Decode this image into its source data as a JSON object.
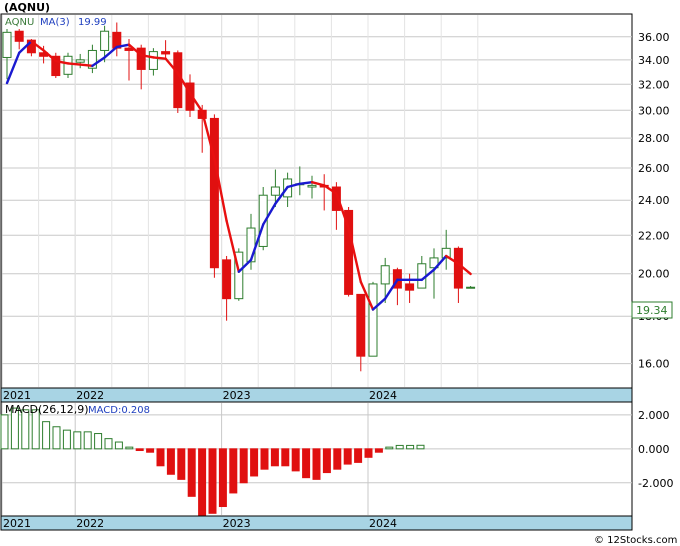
{
  "title": "(AQNU)",
  "watermark": "© 12Stocks.com",
  "colors": {
    "up": "#2e7d2e",
    "down": "#e01010",
    "ma_up": "#1a1ad0",
    "ma_down": "#e81010",
    "axis_band": "#a8d4e4",
    "grid": "#c8c8c8"
  },
  "chart_data": [
    {
      "type": "candlestick",
      "legend": {
        "symbol": "AQNU",
        "ma_label": "MA(3)",
        "ma_value": "19.99",
        "placement": "top-left"
      },
      "last_price": "19.34",
      "y_ticks": [
        "16.00",
        "18.00",
        "20.00",
        "22.00",
        "24.00",
        "26.00",
        "28.00",
        "30.00",
        "32.00",
        "34.00",
        "36.00"
      ],
      "ylim": [
        15.1,
        38.0
      ],
      "log_scale": true,
      "grid": true,
      "x_year_labels": [
        {
          "label": "2021",
          "index": 0
        },
        {
          "label": "2022",
          "index": 6
        },
        {
          "label": "2023",
          "index": 18
        },
        {
          "label": "2024",
          "index": 30
        }
      ],
      "candles": [
        {
          "o": 34.2,
          "h": 36.7,
          "l": 32.4,
          "c": 36.4
        },
        {
          "o": 36.5,
          "h": 36.7,
          "l": 34.9,
          "c": 35.6
        },
        {
          "o": 35.7,
          "h": 35.8,
          "l": 34.3,
          "c": 34.6
        },
        {
          "o": 34.6,
          "h": 35.2,
          "l": 33.7,
          "c": 34.3
        },
        {
          "o": 34.3,
          "h": 34.6,
          "l": 32.5,
          "c": 32.7
        },
        {
          "o": 32.8,
          "h": 34.6,
          "l": 32.5,
          "c": 34.3
        },
        {
          "o": 33.8,
          "h": 34.5,
          "l": 33.3,
          "c": 34.0
        },
        {
          "o": 33.3,
          "h": 35.3,
          "l": 32.9,
          "c": 34.8
        },
        {
          "o": 34.8,
          "h": 37.0,
          "l": 33.8,
          "c": 36.5
        },
        {
          "o": 36.4,
          "h": 37.3,
          "l": 34.3,
          "c": 35.0
        },
        {
          "o": 35.0,
          "h": 35.8,
          "l": 32.3,
          "c": 34.8
        },
        {
          "o": 35.0,
          "h": 35.3,
          "l": 31.6,
          "c": 33.2
        },
        {
          "o": 33.2,
          "h": 35.0,
          "l": 32.7,
          "c": 34.7
        },
        {
          "o": 34.7,
          "h": 35.7,
          "l": 34.2,
          "c": 34.5
        },
        {
          "o": 34.6,
          "h": 34.8,
          "l": 29.8,
          "c": 30.2
        },
        {
          "o": 32.1,
          "h": 32.8,
          "l": 29.5,
          "c": 30.0
        },
        {
          "o": 30.0,
          "h": 30.4,
          "l": 27.0,
          "c": 29.4
        },
        {
          "o": 29.4,
          "h": 29.7,
          "l": 19.8,
          "c": 20.3
        },
        {
          "o": 20.7,
          "h": 20.9,
          "l": 17.8,
          "c": 18.8
        },
        {
          "o": 18.8,
          "h": 21.3,
          "l": 18.7,
          "c": 21.1
        },
        {
          "o": 20.6,
          "h": 23.2,
          "l": 20.2,
          "c": 22.4
        },
        {
          "o": 21.4,
          "h": 24.8,
          "l": 21.2,
          "c": 24.3
        },
        {
          "o": 24.3,
          "h": 25.9,
          "l": 23.6,
          "c": 24.8
        },
        {
          "o": 24.2,
          "h": 25.7,
          "l": 23.6,
          "c": 25.3
        },
        {
          "o": 25.0,
          "h": 26.1,
          "l": 24.3,
          "c": 25.0
        },
        {
          "o": 24.8,
          "h": 25.5,
          "l": 24.1,
          "c": 24.9
        },
        {
          "o": 24.9,
          "h": 25.6,
          "l": 23.4,
          "c": 24.8
        },
        {
          "o": 24.8,
          "h": 25.1,
          "l": 22.3,
          "c": 23.4
        },
        {
          "o": 23.4,
          "h": 23.6,
          "l": 18.9,
          "c": 19.0
        },
        {
          "o": 19.0,
          "h": 19.0,
          "l": 15.7,
          "c": 16.3
        },
        {
          "o": 16.3,
          "h": 19.6,
          "l": 16.3,
          "c": 19.5
        },
        {
          "o": 19.5,
          "h": 20.8,
          "l": 18.6,
          "c": 20.4
        },
        {
          "o": 20.2,
          "h": 20.3,
          "l": 18.5,
          "c": 19.3
        },
        {
          "o": 19.5,
          "h": 20.0,
          "l": 18.6,
          "c": 19.2
        },
        {
          "o": 19.3,
          "h": 20.9,
          "l": 19.3,
          "c": 20.5
        },
        {
          "o": 20.3,
          "h": 21.3,
          "l": 18.8,
          "c": 20.8
        },
        {
          "o": 20.8,
          "h": 22.3,
          "l": 20.2,
          "c": 21.3
        },
        {
          "o": 21.3,
          "h": 21.4,
          "l": 18.6,
          "c": 19.3
        },
        {
          "o": 19.34,
          "h": 19.4,
          "l": 19.3,
          "c": 19.34
        }
      ],
      "ma": [
        32.1,
        34.6,
        35.6,
        34.8,
        33.9,
        33.7,
        33.6,
        33.5,
        34.2,
        35.1,
        35.3,
        34.4,
        34.2,
        34.1,
        32.9,
        31.3,
        29.9,
        26.6,
        22.8,
        20.1,
        20.7,
        22.6,
        23.8,
        24.8,
        25.0,
        25.1,
        24.9,
        24.4,
        22.4,
        19.6,
        18.3,
        18.8,
        19.7,
        19.7,
        19.7,
        20.2,
        20.9,
        20.5,
        19.99
      ]
    },
    {
      "type": "bar",
      "legend": {
        "label": "MACD(26,12,9)",
        "value_label": "MACD:0.208",
        "placement": "top-left"
      },
      "y_ticks": [
        "-2.000",
        "0.000",
        "2.000"
      ],
      "ylim": [
        -3.9,
        2.7
      ],
      "grid": true,
      "values": [
        2.0,
        2.4,
        2.3,
        2.3,
        1.6,
        1.3,
        1.1,
        1.0,
        1.0,
        0.9,
        0.6,
        0.4,
        0.1,
        -0.1,
        -0.2,
        -1.0,
        -1.5,
        -1.8,
        -2.8,
        -3.9,
        -3.8,
        -3.4,
        -2.6,
        -2.0,
        -1.6,
        -1.2,
        -1.0,
        -1.0,
        -1.3,
        -1.7,
        -1.8,
        -1.4,
        -1.2,
        -0.9,
        -0.8,
        -0.5,
        -0.2,
        0.1,
        0.2,
        0.2,
        0.208
      ],
      "x_year_labels": [
        {
          "label": "2021",
          "index": 0
        },
        {
          "label": "2022",
          "index": 6
        },
        {
          "label": "2023",
          "index": 18
        },
        {
          "label": "2024",
          "index": 30
        }
      ]
    }
  ]
}
